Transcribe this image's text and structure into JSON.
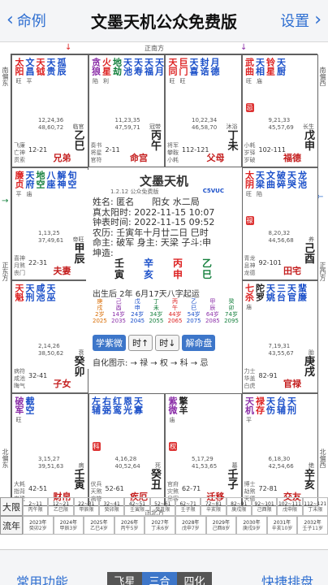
{
  "nav": {
    "back_label": "命例",
    "title": "文墨天机公众免费版",
    "settings_label": "设置"
  },
  "directions": {
    "north": "正北方",
    "south": "正南方",
    "east": "正东方",
    "west": "正西方",
    "southwest": "西南偏南",
    "northwest": "西北偏北",
    "southeast": "东南偏南",
    "northeast": "东北偏北",
    "west_s": "西偏南",
    "west_n": "西偏北",
    "east_s": "东偏南",
    "east_n": "东偏北",
    "north_w": "北偏西",
    "north_e": "北偏东",
    "south_w": "南偏西",
    "south_e": "南偏东"
  },
  "palaces": [
    {
      "stars": [
        {
          "ch": "太阳",
          "lv": "旺",
          "c": "c-red"
        },
        {
          "ch": "文昌",
          "lv": "平",
          "c": "c-blue"
        },
        {
          "ch": "天钺",
          "lv": "",
          "c": "c-red"
        },
        {
          "ch": "天贵",
          "lv": "",
          "c": "c-blue"
        },
        {
          "ch": "孤辰",
          "lv": "",
          "c": "c-blue"
        }
      ],
      "info1": "12,24,36",
      "info2": "48,60,72",
      "changsheng": "临官",
      "small": "飞廉\n亡神\n贯索",
      "range": "12-21",
      "ganzhi": "乙巳",
      "palace": "兄弟"
    },
    {
      "stars": [
        {
          "ch": "贪狼",
          "lv": "陷",
          "c": "c-purple"
        },
        {
          "ch": "火星",
          "lv": "利",
          "c": "c-red"
        },
        {
          "ch": "地劫",
          "lv": "",
          "c": "c-green"
        },
        {
          "ch": "天池",
          "lv": "",
          "c": "c-blue"
        },
        {
          "ch": "天寿",
          "lv": "",
          "c": "c-blue"
        },
        {
          "ch": "天福",
          "lv": "",
          "c": "c-blue"
        },
        {
          "ch": "天月",
          "lv": "",
          "c": "c-blue"
        }
      ],
      "info1": "11,23,35",
      "info2": "47,59,71",
      "changsheng": "冠带",
      "small": "奏书\n将星\n官符",
      "range": "2-11",
      "ganzhi": "丙午",
      "palace": "命宫"
    },
    {
      "stars": [
        {
          "ch": "天同",
          "lv": "旺",
          "c": "c-red"
        },
        {
          "ch": "巨门",
          "lv": "旺",
          "c": "c-red"
        },
        {
          "ch": "天喜",
          "lv": "",
          "c": "c-blue"
        },
        {
          "ch": "封诰",
          "lv": "",
          "c": "c-blue"
        },
        {
          "ch": "月德",
          "lv": "",
          "c": "c-blue"
        }
      ],
      "info1": "10,22,34",
      "info2": "46,58,70",
      "changsheng": "沐浴",
      "small": "将军\n攀鞍\n小耗",
      "range": "112-121",
      "ganzhi": "丁未",
      "palace": "父母"
    },
    {
      "stars": [
        {
          "ch": "武曲",
          "lv": "旺",
          "c": "c-red"
        },
        {
          "ch": "天相",
          "lv": "庙",
          "c": "c-blue"
        },
        {
          "ch": "铃星",
          "lv": "",
          "c": "c-red"
        },
        {
          "ch": "天厨",
          "lv": "",
          "c": "c-blue"
        }
      ],
      "info1": "9,21,33",
      "info2": "45,57,69",
      "changsheng": "长生",
      "small": "小耗\n岁驿\n岁破",
      "range": "102-111",
      "ganzhi": "戊申",
      "palace": "福德",
      "sihua": "忌"
    },
    {
      "stars": [
        {
          "ch": "廉贞",
          "lv": "平",
          "c": "c-red"
        },
        {
          "ch": "天府",
          "lv": "庙",
          "c": "c-blue"
        },
        {
          "ch": "地空",
          "lv": "",
          "c": "c-green"
        },
        {
          "ch": "八座",
          "lv": "",
          "c": "c-blue"
        },
        {
          "ch": "解神",
          "lv": "",
          "c": "c-blue"
        },
        {
          "ch": "旬空",
          "lv": "",
          "c": "c-blue"
        }
      ],
      "info1": "1,13,25",
      "info2": "37,49,61",
      "changsheng": "帝旺",
      "small": "喜神\n月煞\n丧门",
      "range": "22-31",
      "ganzhi": "甲辰",
      "palace": "夫妻"
    },
    {
      "stars": [
        {
          "ch": "太阴",
          "lv": "旺",
          "c": "c-red"
        },
        {
          "ch": "天梁",
          "lv": "陷",
          "c": "c-blue"
        },
        {
          "ch": "文曲",
          "lv": "",
          "c": "c-blue"
        },
        {
          "ch": "破碎",
          "lv": "",
          "c": "c-blue"
        },
        {
          "ch": "天哭",
          "lv": "",
          "c": "c-blue"
        },
        {
          "ch": "龙池",
          "lv": "",
          "c": "c-blue"
        }
      ],
      "info1": "8,20,32",
      "info2": "44,56,68",
      "changsheng": "养",
      "small": "青龙\n息神\n龙德",
      "range": "92-101",
      "ganzhi": "己酉",
      "palace": "田宅",
      "sihua": "禄"
    },
    {
      "stars": [
        {
          "ch": "天魁",
          "lv": "",
          "c": "c-red"
        },
        {
          "ch": "天刑",
          "lv": "",
          "c": "c-blue"
        },
        {
          "ch": "咸池",
          "lv": "",
          "c": "c-blue"
        },
        {
          "ch": "天巫",
          "lv": "",
          "c": "c-blue"
        }
      ],
      "info1": "2,14,26",
      "info2": "38,50,62",
      "changsheng": "衰",
      "small": "病符\n咸池\n晦气",
      "range": "32-41",
      "ganzhi": "癸卯",
      "palace": "子女"
    },
    {
      "stars": [
        {
          "ch": "七杀",
          "lv": "庙",
          "c": "c-red"
        },
        {
          "ch": "陀罗",
          "lv": "",
          "c": "c-dark"
        },
        {
          "ch": "天姚",
          "lv": "",
          "c": "c-blue"
        },
        {
          "ch": "三台",
          "lv": "",
          "c": "c-blue"
        },
        {
          "ch": "天官",
          "lv": "",
          "c": "c-blue"
        },
        {
          "ch": "蜚廉",
          "lv": "",
          "c": "c-blue"
        }
      ],
      "info1": "7,19,31",
      "info2": "43,55,67",
      "changsheng": "胎",
      "small": "力士\n华盖\n白虎",
      "range": "82-91",
      "ganzhi": "庚戌",
      "palace": "官禄"
    },
    {
      "stars": [
        {
          "ch": "破军",
          "lv": "旺",
          "c": "c-purple"
        },
        {
          "ch": "截空",
          "lv": "",
          "c": "c-blue"
        }
      ],
      "info1": "3,15,27",
      "info2": "39,51,63",
      "changsheng": "病",
      "small": "大耗\n指背\n岁建",
      "range": "42-51",
      "ganzhi": "壬寅",
      "palace": "财帛"
    },
    {
      "stars": [
        {
          "ch": "左辅",
          "lv": "",
          "c": "c-blue"
        },
        {
          "ch": "右弼",
          "lv": "",
          "c": "c-blue"
        },
        {
          "ch": "红鸾",
          "lv": "",
          "c": "c-blue"
        },
        {
          "ch": "恩光",
          "lv": "",
          "c": "c-blue"
        },
        {
          "ch": "天寡",
          "lv": "",
          "c": "c-blue"
        }
      ],
      "info1": "4,16,28",
      "info2": "40,52,64",
      "changsheng": "死",
      "small": "伏兵\n天煞\n病符",
      "range": "52-61",
      "ganzhi": "癸丑",
      "palace": "疾厄",
      "sihua": "科"
    },
    {
      "stars": [
        {
          "ch": "紫微",
          "lv": "庙",
          "c": "c-purple"
        },
        {
          "ch": "擎羊",
          "lv": "",
          "c": "c-dark"
        }
      ],
      "info1": "5,17,29",
      "info2": "41,53,65",
      "changsheng": "墓",
      "small": "官府\n灾煞\n吊客",
      "range": "62-71",
      "ganzhi": "壬子",
      "palace": "迁移",
      "sihua": "权"
    },
    {
      "stars": [
        {
          "ch": "天机",
          "lv": "平",
          "c": "c-purple"
        },
        {
          "ch": "禄存",
          "lv": "",
          "c": "c-red"
        },
        {
          "ch": "天伤",
          "lv": "",
          "c": "c-blue"
        },
        {
          "ch": "台辅",
          "lv": "",
          "c": "c-blue"
        },
        {
          "ch": "天刑",
          "lv": "",
          "c": "c-blue"
        }
      ],
      "info1": "6,18,30",
      "info2": "42,54,66",
      "changsheng": "绝",
      "small": "博士\n劫煞\n天德",
      "range": "72-81",
      "ganzhi": "辛亥",
      "palace": "交友"
    }
  ],
  "center": {
    "title": "文墨天机",
    "version": "1.2.12 公众免费版",
    "code": "C5VUC",
    "lines": [
      "姓名: 匿名　　阳女 水二局",
      "真太阳时: 2022-11-15 10:07",
      "钟表时间: 2022-11-15 09:52",
      "农历: 壬寅年十月廿二日 巳时",
      "命主: 破军 身主: 天梁 子斗:申",
      "坤造:"
    ],
    "bazi": [
      {
        "g": "壬",
        "z": "寅"
      },
      {
        "g": "辛",
        "z": "亥"
      },
      {
        "g": "丙",
        "z": "申"
      },
      {
        "g": "乙",
        "z": "巳"
      }
    ],
    "born": "出生后 2年 6月17天八字起运",
    "dayun": [
      {
        "a": "庚",
        "b": "戌",
        "age": "2岁",
        "y": "2025"
      },
      {
        "a": "己",
        "b": "酉",
        "age": "14岁",
        "y": "2035"
      },
      {
        "a": "戊",
        "b": "申",
        "age": "24岁",
        "y": "2045"
      },
      {
        "a": "丁",
        "b": "未",
        "age": "34岁",
        "y": "2055"
      },
      {
        "a": "丙",
        "b": "午",
        "age": "44岁",
        "y": "2065"
      },
      {
        "a": "乙",
        "b": "巳",
        "age": "54岁",
        "y": "2075"
      },
      {
        "a": "甲",
        "b": "辰",
        "age": "64岁",
        "y": "2085"
      },
      {
        "a": "癸",
        "b": "卯",
        "age": "74岁",
        "y": "2095"
      }
    ],
    "buttons": {
      "ziwei": "学紫微",
      "time_up": "时↑",
      "time_down": "时↓",
      "explain": "解命盘"
    },
    "auto": "自化图示: → 禄 → 权 → 科 → 忌"
  },
  "limits": {
    "daxian_label": "大限",
    "liunian_label": "流年",
    "daxian": [
      {
        "r": "2~11",
        "g": "丙午限"
      },
      {
        "r": "12~21",
        "g": "乙巳限"
      },
      {
        "r": "22~31",
        "g": "甲辰限"
      },
      {
        "r": "32~41",
        "g": "癸卯限"
      },
      {
        "r": "42~51",
        "g": "壬寅限"
      },
      {
        "r": "52~61",
        "g": "癸丑限"
      },
      {
        "r": "62~71",
        "g": "壬子限"
      },
      {
        "r": "72~81",
        "g": "辛亥限"
      },
      {
        "r": "82~91",
        "g": "庚戌限"
      },
      {
        "r": "92~101",
        "g": "己酉限"
      },
      {
        "r": "102~111",
        "g": "戊申限"
      },
      {
        "r": "112~121",
        "g": "丁未限"
      }
    ],
    "liunian": [
      {
        "r": "2023年",
        "g": "癸卯2岁"
      },
      {
        "r": "2024年",
        "g": "甲辰3岁"
      },
      {
        "r": "2025年",
        "g": "乙巳4岁"
      },
      {
        "r": "2026年",
        "g": "丙午5岁"
      },
      {
        "r": "2027年",
        "g": "丁未6岁"
      },
      {
        "r": "2028年",
        "g": "戊申7岁"
      },
      {
        "r": "2029年",
        "g": "己酉8岁"
      },
      {
        "r": "2030年",
        "g": "庚戌9岁"
      },
      {
        "r": "2031年",
        "g": "辛亥10岁"
      },
      {
        "r": "2032年",
        "g": "壬子11岁"
      }
    ]
  },
  "bottom": {
    "left": "常用功能",
    "right": "快捷排盘",
    "seg": [
      "飞星",
      "三合",
      "四化"
    ]
  }
}
